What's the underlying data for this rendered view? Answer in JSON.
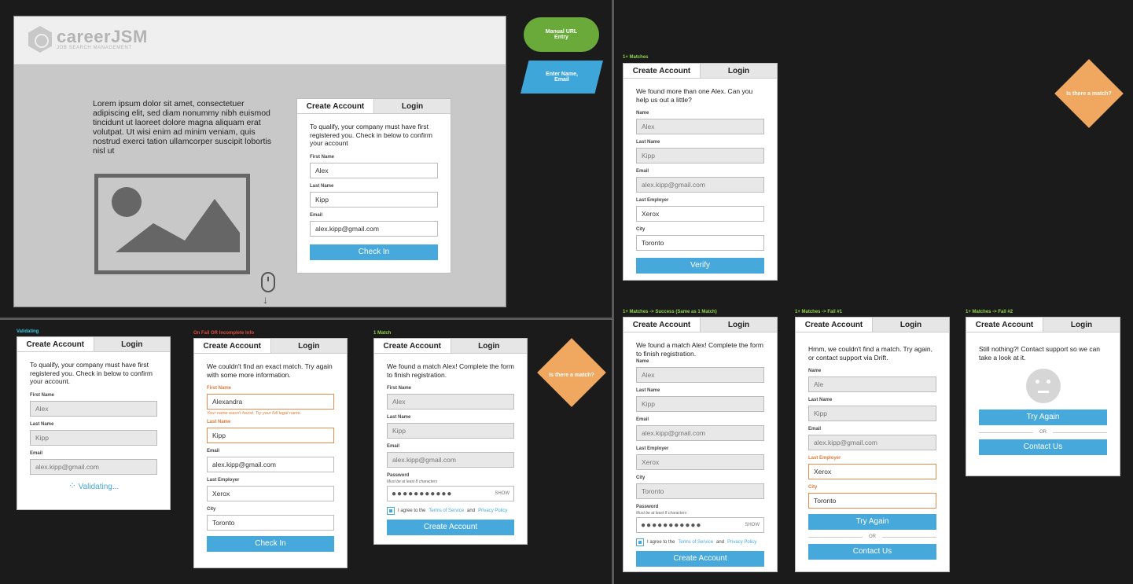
{
  "main": {
    "logo_text": "careerJSM",
    "logo_sub": "JOB SEARCH MANAGEMENT",
    "lorem": "Lorem ipsum dolor sit amet, consectetuer adipiscing elit, sed diam nonummy nibh euismod tincidunt ut laoreet dolore magna aliquam erat volutpat. Ut wisi enim ad minim veniam, quis nostrud exerci tation ullamcorper suscipit lobortis nisl ut"
  },
  "tabs": {
    "create": "Create Account",
    "login": "Login"
  },
  "labels": {
    "first_name": "First Name",
    "last_name": "Last Name",
    "email": "Email",
    "name": "Name",
    "last_employer": "Last Employer",
    "city": "City",
    "password": "Password",
    "password_hint": "Must be at least 8 characters",
    "show": "SHOW",
    "or": "OR",
    "agree_pre": "I agree to the",
    "terms": "Terms of Service",
    "and": "and",
    "privacy": "Privacy Policy"
  },
  "values": {
    "alex": "Alex",
    "kipp": "Kipp",
    "email": "alex.kipp@gmail.com",
    "alexandra": "Alexandra",
    "ale": "Ale",
    "xerox": "Xerox",
    "toronto": "Toronto",
    "password_mask": "●●●●●●●●●●●"
  },
  "flow": {
    "manual_entry": "Manual URL Entry",
    "enter_name": "Enter Name, Email",
    "is_match_1": "Is there a match?",
    "is_match_2": "Is there a match?"
  },
  "main_card": {
    "msg": "To qualify, your company must have first registered you. Check in below to confirm your account",
    "button": "Check In"
  },
  "validating": {
    "step": "Validating",
    "msg": "To qualify, your company must have first registered you. Check in below to confirm your account.",
    "status": "Validating..."
  },
  "fail": {
    "step": "On Fail OR Incomplete Info",
    "msg": "We couldn't find an exact match. Try again with some more information.",
    "error": "Your name wasn't found. Try your full legal name.",
    "button": "Check In"
  },
  "one_match": {
    "step": "1 Match",
    "msg": "We found a match Alex! Complete the form to finish registration.",
    "button": "Create Account"
  },
  "multi": {
    "step": "1+ Matches",
    "msg": "We found more than one Alex. Can you help us out a little?",
    "button": "Verify"
  },
  "success": {
    "step": "1+ Matches -> Success (Same as 1 Match)",
    "msg": "We found a match Alex! Complete the form to finish registration.",
    "button": "Create Account"
  },
  "fail1": {
    "step": "1+ Matches -> Fail #1",
    "msg": "Hmm, we couldn't find a match. Try again, or contact support via Drift.",
    "try": "Try Again",
    "contact": "Contact Us"
  },
  "fail2": {
    "step": "1+ Matches -> Fail #2",
    "msg": "Still nothing?! Contact support so we can take a look at it.",
    "try": "Try Again",
    "contact": "Contact Us"
  },
  "colors": {
    "accent": "#47a8dc",
    "green_flow": "#6aaa3a",
    "diamond": "#f0a860",
    "error": "#e07a3a"
  }
}
